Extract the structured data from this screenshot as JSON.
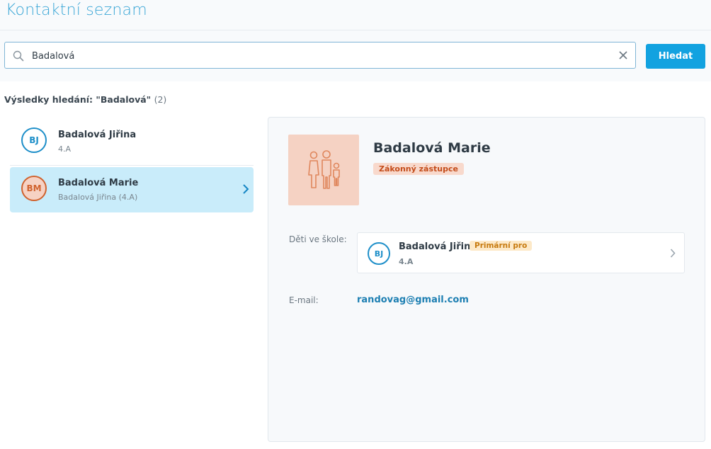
{
  "page": {
    "title": "Kontaktní seznam"
  },
  "search": {
    "value": "Badalová",
    "button_label": "Hledat"
  },
  "results": {
    "heading": "Výsledky hledání: \"Badalová\"",
    "count": "(2)",
    "items": [
      {
        "initials": "BJ",
        "name": "Badalová Jiřina",
        "sub": "4.A",
        "selected": false
      },
      {
        "initials": "BM",
        "name": "Badalová Marie",
        "sub": "Badalová Jiřina (4.A)",
        "selected": true
      }
    ]
  },
  "detail": {
    "name": "Badalová Marie",
    "role": "Zákonný zástupce",
    "children_label": "Děti ve škole:",
    "child": {
      "initials": "BJ",
      "name": "Badalová Jiřina",
      "badge": "Primární pro",
      "class": "4.A"
    },
    "email_label": "E-mail:",
    "email": "randovag@gmail.com"
  },
  "colors": {
    "accent": "#12a2e0",
    "selected_row": "#c9ecfa",
    "avatar_blue": "#1e8fc9",
    "avatar_orange": "#d0622e",
    "role_badge_bg": "#f8d9cc",
    "primary_badge_bg": "#fde9c8"
  },
  "icons": {
    "search": "search-icon",
    "clear": "close-icon",
    "chevron": "chevron-right-icon",
    "family": "family-icon"
  }
}
